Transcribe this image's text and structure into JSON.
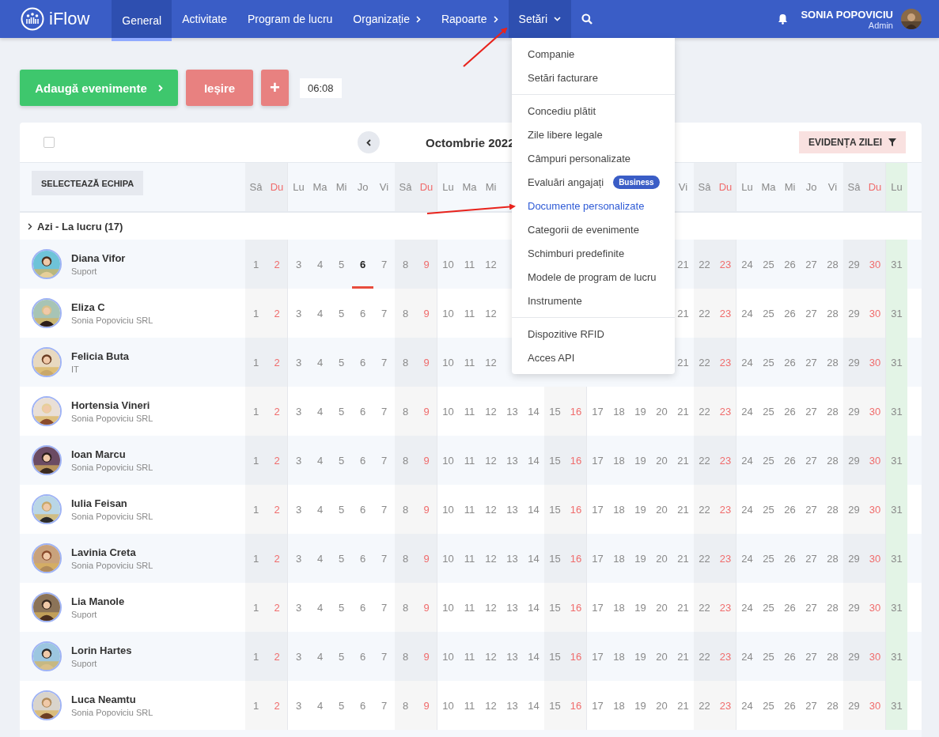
{
  "nav": {
    "logo": "iFlow",
    "tabs": [
      {
        "label": "General",
        "selected": true,
        "kind": "link"
      },
      {
        "label": "Activitate",
        "selected": false,
        "kind": "link"
      },
      {
        "label": "Program de lucru",
        "selected": false,
        "kind": "link"
      },
      {
        "label": "Organizație",
        "selected": false,
        "kind": "submenu"
      },
      {
        "label": "Rapoarte",
        "selected": false,
        "kind": "submenu"
      },
      {
        "label": "Setări",
        "selected": false,
        "open": true,
        "kind": "dropdown"
      }
    ],
    "user": {
      "name": "SONIA POPOVICIU",
      "role": "Admin"
    }
  },
  "settings_menu": [
    [
      {
        "label": "Companie",
        "selected": false
      },
      {
        "label": "Setări facturare",
        "selected": false
      }
    ],
    [
      {
        "label": "Concediu plătit",
        "selected": false
      },
      {
        "label": "Zile libere legale",
        "selected": false
      },
      {
        "label": "Câmpuri personalizate",
        "selected": false
      },
      {
        "label": "Evaluări angajați",
        "selected": false,
        "badge": "Business"
      },
      {
        "label": "Documente personalizate",
        "selected": true
      },
      {
        "label": "Categorii de evenimente",
        "selected": false
      },
      {
        "label": "Schimburi predefinite",
        "selected": false
      },
      {
        "label": "Modele de program de lucru",
        "selected": false
      },
      {
        "label": "Instrumente",
        "selected": false
      }
    ],
    [
      {
        "label": "Dispozitive RFID",
        "selected": false
      },
      {
        "label": "Acces API",
        "selected": false
      }
    ]
  ],
  "actions": {
    "add": "Adaugă evenimente",
    "exit": "Ieșire",
    "plus": "+",
    "time": "06:08"
  },
  "calendar": {
    "select_all_checked": false,
    "month": "Octombrie 2022",
    "filter": "EVIDENȚA ZILEI",
    "team_button": "SELECTEAZĂ ECHIPA",
    "columns": [
      {
        "kind": "sat"
      },
      {
        "kind": "sun"
      },
      {
        "kind": "work"
      },
      {
        "kind": "work"
      },
      {
        "kind": "work"
      },
      {
        "kind": "today"
      },
      {
        "kind": "work"
      },
      {
        "kind": "sat"
      },
      {
        "kind": "sun"
      },
      {
        "kind": "work"
      },
      {
        "kind": "work"
      },
      {
        "kind": "work"
      },
      {
        "kind": "work"
      },
      {
        "kind": "work"
      },
      {
        "kind": "sat"
      },
      {
        "kind": "sun"
      },
      {
        "kind": "work"
      },
      {
        "kind": "work"
      },
      {
        "kind": "work"
      },
      {
        "kind": "work"
      },
      {
        "kind": "work"
      },
      {
        "kind": "sat"
      },
      {
        "kind": "sun"
      },
      {
        "kind": "work"
      },
      {
        "kind": "work"
      },
      {
        "kind": "work"
      },
      {
        "kind": "work"
      },
      {
        "kind": "work"
      },
      {
        "kind": "sat"
      },
      {
        "kind": "sun"
      },
      {
        "kind": "highlight"
      }
    ],
    "weekdays_before": [
      "Sâ",
      "Du",
      "Lu",
      "Ma",
      "Mi",
      "Jo",
      "Vi",
      "Sâ",
      "Du",
      "Lu",
      "Ma",
      "Mi"
    ],
    "weekdays_after": [
      "Vi",
      "Sâ",
      "Du",
      "Lu",
      "Ma",
      "Mi",
      "Jo",
      "Vi",
      "Sâ",
      "Du",
      "Lu"
    ],
    "section": "Azi - La lucru (17)",
    "rows": [
      {
        "name": "Diana Vifor",
        "subtitle": "Suport",
        "highlight_today": true,
        "days_before": [
          "1",
          "2",
          "3",
          "4",
          "5",
          "6",
          "7",
          "8",
          "9",
          "10",
          "11",
          "12"
        ],
        "days_after": [
          "21",
          "22",
          "23",
          "24",
          "25",
          "26",
          "27",
          "28",
          "29",
          "30",
          "31"
        ]
      },
      {
        "name": "Eliza C",
        "subtitle": "Sonia Popoviciu SRL",
        "highlight_today": false,
        "days_before": [
          "1",
          "2",
          "3",
          "4",
          "5",
          "6",
          "7",
          "8",
          "9",
          "10",
          "11",
          "12"
        ],
        "days_after": [
          "21",
          "22",
          "23",
          "24",
          "25",
          "26",
          "27",
          "28",
          "29",
          "30",
          "31"
        ]
      },
      {
        "name": "Felicia Buta",
        "subtitle": "IT",
        "highlight_today": false,
        "days_before": [
          "1",
          "2",
          "3",
          "4",
          "5",
          "6",
          "7",
          "8",
          "9",
          "10",
          "11",
          "12"
        ],
        "days_after": [
          "21",
          "22",
          "23",
          "24",
          "25",
          "26",
          "27",
          "28",
          "29",
          "30",
          "31"
        ]
      },
      {
        "name": "Hortensia Vineri",
        "subtitle": "Sonia Popoviciu SRL",
        "highlight_today": false,
        "days_before": [
          "1",
          "2",
          "3",
          "4",
          "5",
          "6",
          "7",
          "8",
          "9",
          "10",
          "11",
          "12",
          "13",
          "14",
          "15",
          "16",
          "17",
          "18",
          "19",
          "20",
          "21",
          "22",
          "23",
          "24",
          "25",
          "26",
          "27",
          "28",
          "29",
          "30",
          "31"
        ]
      },
      {
        "name": "Ioan Marcu",
        "subtitle": "Sonia Popoviciu SRL",
        "highlight_today": false,
        "days_before": [
          "1",
          "2",
          "3",
          "4",
          "5",
          "6",
          "7",
          "8",
          "9",
          "10",
          "11",
          "12",
          "13",
          "14",
          "15",
          "16",
          "17",
          "18",
          "19",
          "20",
          "21",
          "22",
          "23",
          "24",
          "25",
          "26",
          "27",
          "28",
          "29",
          "30",
          "31"
        ]
      },
      {
        "name": "Iulia Feisan",
        "subtitle": "Sonia Popoviciu SRL",
        "highlight_today": false,
        "days_before": [
          "1",
          "2",
          "3",
          "4",
          "5",
          "6",
          "7",
          "8",
          "9",
          "10",
          "11",
          "12",
          "13",
          "14",
          "15",
          "16",
          "17",
          "18",
          "19",
          "20",
          "21",
          "22",
          "23",
          "24",
          "25",
          "26",
          "27",
          "28",
          "29",
          "30",
          "31"
        ]
      },
      {
        "name": "Lavinia Creta",
        "subtitle": "Sonia Popoviciu SRL",
        "highlight_today": false,
        "days_before": [
          "1",
          "2",
          "3",
          "4",
          "5",
          "6",
          "7",
          "8",
          "9",
          "10",
          "11",
          "12",
          "13",
          "14",
          "15",
          "16",
          "17",
          "18",
          "19",
          "20",
          "21",
          "22",
          "23",
          "24",
          "25",
          "26",
          "27",
          "28",
          "29",
          "30",
          "31"
        ]
      },
      {
        "name": "Lia Manole",
        "subtitle": "Suport",
        "highlight_today": false,
        "days_before": [
          "1",
          "2",
          "3",
          "4",
          "5",
          "6",
          "7",
          "8",
          "9",
          "10",
          "11",
          "12",
          "13",
          "14",
          "15",
          "16",
          "17",
          "18",
          "19",
          "20",
          "21",
          "22",
          "23",
          "24",
          "25",
          "26",
          "27",
          "28",
          "29",
          "30",
          "31"
        ]
      },
      {
        "name": "Lorin Hartes",
        "subtitle": "Suport",
        "highlight_today": false,
        "days_before": [
          "1",
          "2",
          "3",
          "4",
          "5",
          "6",
          "7",
          "8",
          "9",
          "10",
          "11",
          "12",
          "13",
          "14",
          "15",
          "16",
          "17",
          "18",
          "19",
          "20",
          "21",
          "22",
          "23",
          "24",
          "25",
          "26",
          "27",
          "28",
          "29",
          "30",
          "31"
        ]
      },
      {
        "name": "Luca Neamtu",
        "subtitle": "Sonia Popoviciu SRL",
        "highlight_today": false,
        "days_before": [
          "1",
          "2",
          "3",
          "4",
          "5",
          "6",
          "7",
          "8",
          "9",
          "10",
          "11",
          "12",
          "13",
          "14",
          "15",
          "16",
          "17",
          "18",
          "19",
          "20",
          "21",
          "22",
          "23",
          "24",
          "25",
          "26",
          "27",
          "28",
          "29",
          "30",
          "31"
        ]
      }
    ]
  }
}
